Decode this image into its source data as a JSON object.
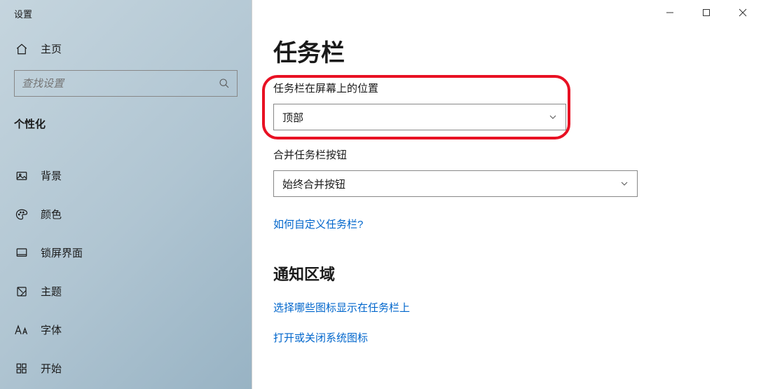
{
  "app": {
    "name": "设置"
  },
  "titlebar": {
    "min": "—",
    "max": "□",
    "close": "✕"
  },
  "sidebar": {
    "home": "主页",
    "searchPlaceholder": "查找设置",
    "category": "个性化",
    "items": [
      {
        "label": "背景"
      },
      {
        "label": "颜色"
      },
      {
        "label": "锁屏界面"
      },
      {
        "label": "主题"
      },
      {
        "label": "字体"
      },
      {
        "label": "开始"
      }
    ]
  },
  "content": {
    "title": "任务栏",
    "position": {
      "label": "任务栏在屏幕上的位置",
      "value": "顶部"
    },
    "combine": {
      "label": "合并任务栏按钮",
      "value": "始终合并按钮"
    },
    "customizeLink": "如何自定义任务栏?",
    "notifyTitle": "通知区域",
    "iconsLink": "选择哪些图标显示在任务栏上",
    "systemIconsLink": "打开或关闭系统图标"
  }
}
